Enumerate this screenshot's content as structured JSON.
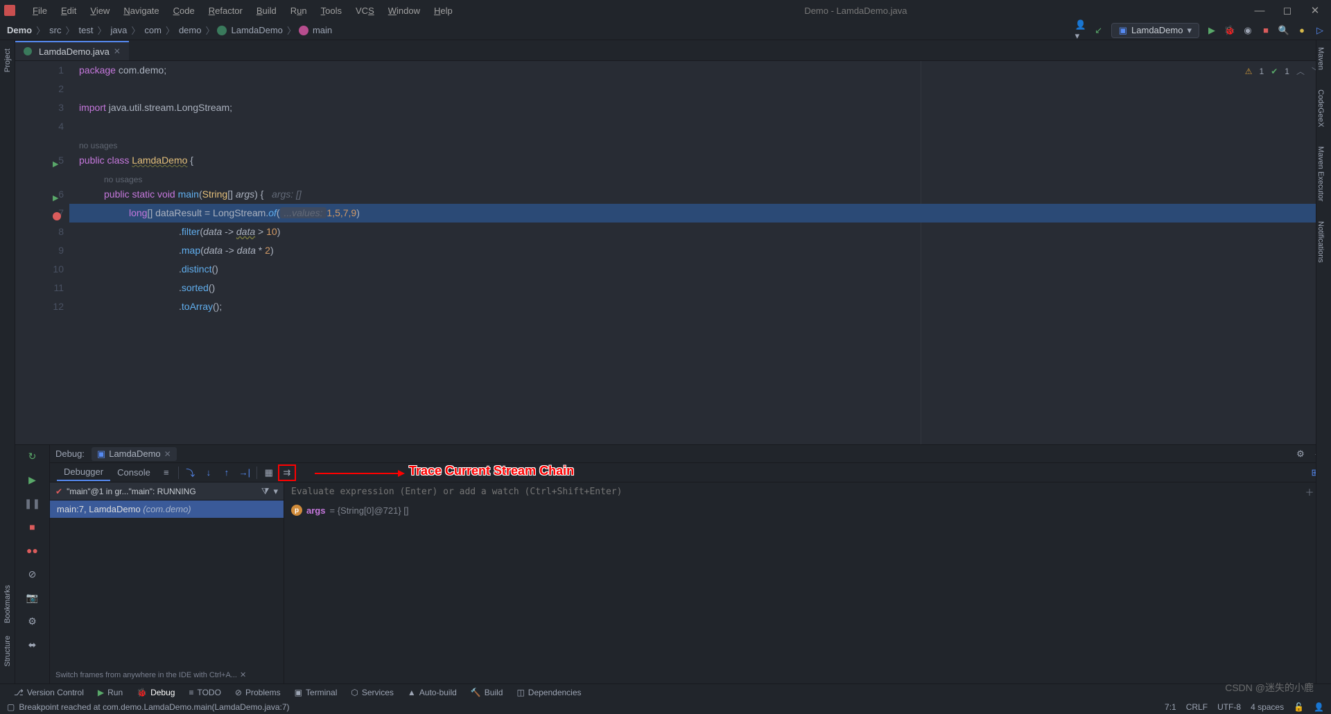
{
  "window": {
    "title": "Demo - LamdaDemo.java"
  },
  "menu": [
    "File",
    "Edit",
    "View",
    "Navigate",
    "Code",
    "Refactor",
    "Build",
    "Run",
    "Tools",
    "VCS",
    "Window",
    "Help"
  ],
  "breadcrumbs": [
    "Demo",
    "src",
    "test",
    "java",
    "com",
    "demo",
    "LamdaDemo",
    "main"
  ],
  "run_config": "LamdaDemo",
  "file_tab": "LamdaDemo.java",
  "inspection": {
    "warnings": "1",
    "passes": "1"
  },
  "code": {
    "l1_kw1": "package ",
    "l1_pkg": "com.demo",
    "l1_semi": ";",
    "l3_kw": "import ",
    "l3_pkg": "java.util.stream.LongStream",
    "l3_semi": ";",
    "usage_hint": "no usages",
    "l5": "public class LamdaDemo {",
    "l5_kw1": "public class ",
    "l5_cls": "LamdaDemo",
    "l5_brace": " {",
    "l6_kw": "public static void ",
    "l6_fn": "main",
    "l6_p1": "(",
    "l6_type": "String",
    "l6_arr": "[] ",
    "l6_arg": "args",
    "l6_p2": ") {",
    "l6_hint": "   args: []",
    "l7_type": "long",
    "l7_arr": "[] ",
    "l7_var": "dataResult",
    "l7_eq": " = ",
    "l7_cls": "LongStream",
    "l7_dot": ".",
    "l7_fn": "of",
    "l7_p1": "(",
    "l7_hint": " ...values: ",
    "l7_nums": "1,5,7,9",
    "l7_p2": ")",
    "l8_dot": ".",
    "l8_fn": "filter",
    "l8_p1": "(",
    "l8_a": "data",
    "l8_arrow": " -> ",
    "l8_b": "data",
    "l8_gt": " > ",
    "l8_n": "10",
    "l8_p2": ")",
    "l9_dot": ".",
    "l9_fn": "map",
    "l9_p1": "(",
    "l9_a": "data",
    "l9_arrow": " -> ",
    "l9_b": "data",
    "l9_m": " * ",
    "l9_n": "2",
    "l9_p2": ")",
    "l10_dot": ".",
    "l10_fn": "distinct",
    "l10_p": "()",
    "l11_dot": ".",
    "l11_fn": "sorted",
    "l11_p": "()",
    "l12_dot": ".",
    "l12_fn": "toArray",
    "l12_p": "();"
  },
  "debug": {
    "label": "Debug:",
    "config": "LamdaDemo",
    "tab_debugger": "Debugger",
    "tab_console": "Console",
    "thread": "\"main\"@1 in gr...\"main\": RUNNING",
    "frame_loc": "main:7, LamdaDemo ",
    "frame_pkg": "(com.demo)",
    "frames_hint": "Switch frames from anywhere in the IDE with Ctrl+A...",
    "eval_placeholder": "Evaluate expression (Enter) or add a watch (Ctrl+Shift+Enter)",
    "var_name": "args",
    "var_eq": " = ",
    "var_type": "{String[0]@721}",
    "var_val": " []"
  },
  "annotation": "Trace Current Stream Chain",
  "bottom": {
    "version": "Version Control",
    "run": "Run",
    "debug": "Debug",
    "todo": "TODO",
    "problems": "Problems",
    "terminal": "Terminal",
    "services": "Services",
    "autobuild": "Auto-build",
    "build": "Build",
    "deps": "Dependencies"
  },
  "status": {
    "msg": "Breakpoint reached at com.demo.LamdaDemo.main(LamdaDemo.java:7)",
    "pos": "7:1",
    "crlf": "CRLF",
    "enc": "UTF-8",
    "indent": "4 spaces"
  },
  "side": {
    "project": "Project",
    "bookmarks": "Bookmarks",
    "structure": "Structure",
    "maven": "Maven",
    "codegeex": "CodeGeeX",
    "mvnexec": "Maven Executor",
    "notif": "Notifications"
  },
  "watermark": "CSDN @迷失的小鹿",
  "lines": [
    "1",
    "2",
    "3",
    "4",
    "5",
    "6",
    "7",
    "8",
    "9",
    "10",
    "11",
    "12"
  ]
}
